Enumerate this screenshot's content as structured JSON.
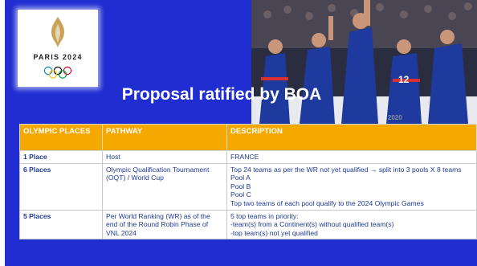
{
  "title": "Proposal ratified by BOA",
  "logo": {
    "text": "PARIS 2024",
    "flame_color": "#c8a45a",
    "rings_colors": [
      "#0085c7",
      "#000000",
      "#df0024",
      "#f4c300",
      "#009f3d"
    ]
  },
  "photo": {
    "jersey_numbers": [
      "12"
    ],
    "text_2020": "2020"
  },
  "colors": {
    "slide_bg": "#1f2dd1",
    "header_bg": "#f5a800",
    "cell_text": "#1f3a93"
  },
  "table": {
    "headers": [
      "OLYMPIC PLACES",
      "PATHWAY",
      "DESCRIPTION"
    ],
    "rows": [
      {
        "places": "1 Place",
        "pathway": "Host",
        "description": [
          "FRANCE"
        ]
      },
      {
        "places": "6 Places",
        "pathway": "Olympic Qualification Tournament (OQT) / World Cup",
        "description": [
          "Top 24 teams as per the WR not yet qualified  →  split into 3 pools X 8 teams",
          "Pool A",
          "Pool B",
          "Pool C",
          "Top two teams of each pool qualify to the 2024 Olympic Games"
        ]
      },
      {
        "places": "5 Places",
        "pathway": "Per World Ranking (WR) as of the end of the Round Robin Phase of VNL 2024",
        "description": [
          "5 top teams in priority:",
          "-team(s) from a Continent(s) without qualified team(s)",
          "-top team(s) not yet qualified"
        ]
      }
    ]
  }
}
